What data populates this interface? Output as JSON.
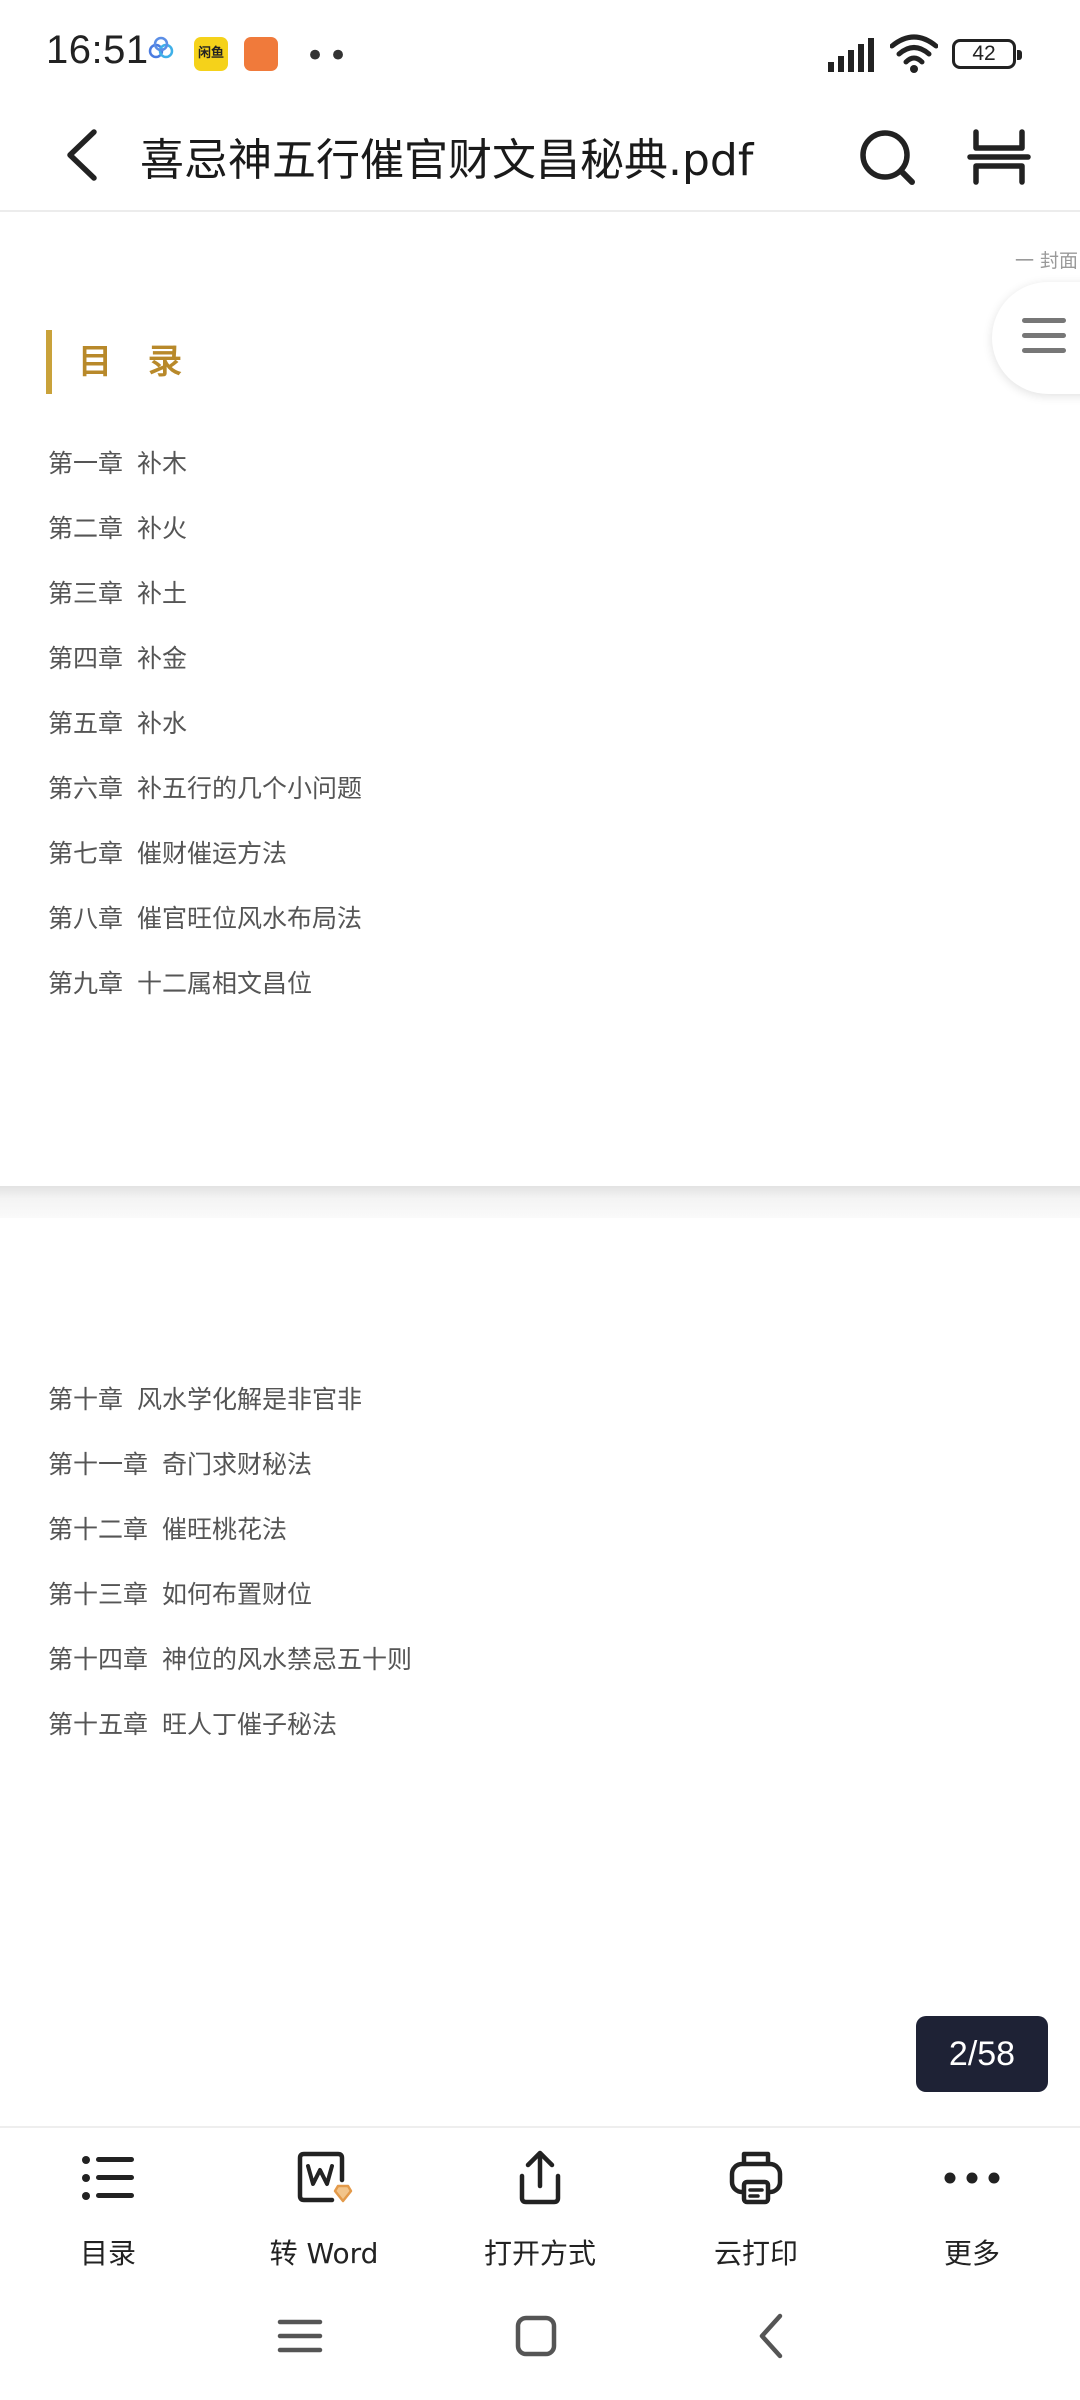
{
  "status": {
    "time": "16:51",
    "app_icon_label": "闲鱼",
    "overflow": "••",
    "battery": "42"
  },
  "header": {
    "title": "喜忌神五行催官财文昌秘典.pdf"
  },
  "page1": {
    "bookmark_hint": "一 封面",
    "toc_heading": "目 录",
    "items": [
      {
        "chapter": "第一章",
        "title": "补木"
      },
      {
        "chapter": "第二章",
        "title": "补火"
      },
      {
        "chapter": "第三章",
        "title": "补土"
      },
      {
        "chapter": "第四章",
        "title": "补金"
      },
      {
        "chapter": "第五章",
        "title": "补水"
      },
      {
        "chapter": "第六章",
        "title": "补五行的几个小问题"
      },
      {
        "chapter": "第七章",
        "title": "催财催运方法"
      },
      {
        "chapter": "第八章",
        "title": "催官旺位风水布局法"
      },
      {
        "chapter": "第九章",
        "title": "十二属相文昌位"
      }
    ]
  },
  "page2": {
    "items": [
      {
        "chapter": "第十章",
        "title": "风水学化解是非官非"
      },
      {
        "chapter": "第十一章",
        "title": "奇门求财秘法"
      },
      {
        "chapter": "第十二章",
        "title": "催旺桃花法"
      },
      {
        "chapter": "第十三章",
        "title": "如何布置财位"
      },
      {
        "chapter": "第十四章",
        "title": "神位的风水禁忌五十则"
      },
      {
        "chapter": "第十五章",
        "title": "旺人丁催子秘法"
      }
    ]
  },
  "page_indicator": "2/58",
  "toolbar": {
    "toc": "目录",
    "to_word": "转 Word",
    "open_with": "打开方式",
    "cloud_print": "云打印",
    "more": "更多"
  }
}
